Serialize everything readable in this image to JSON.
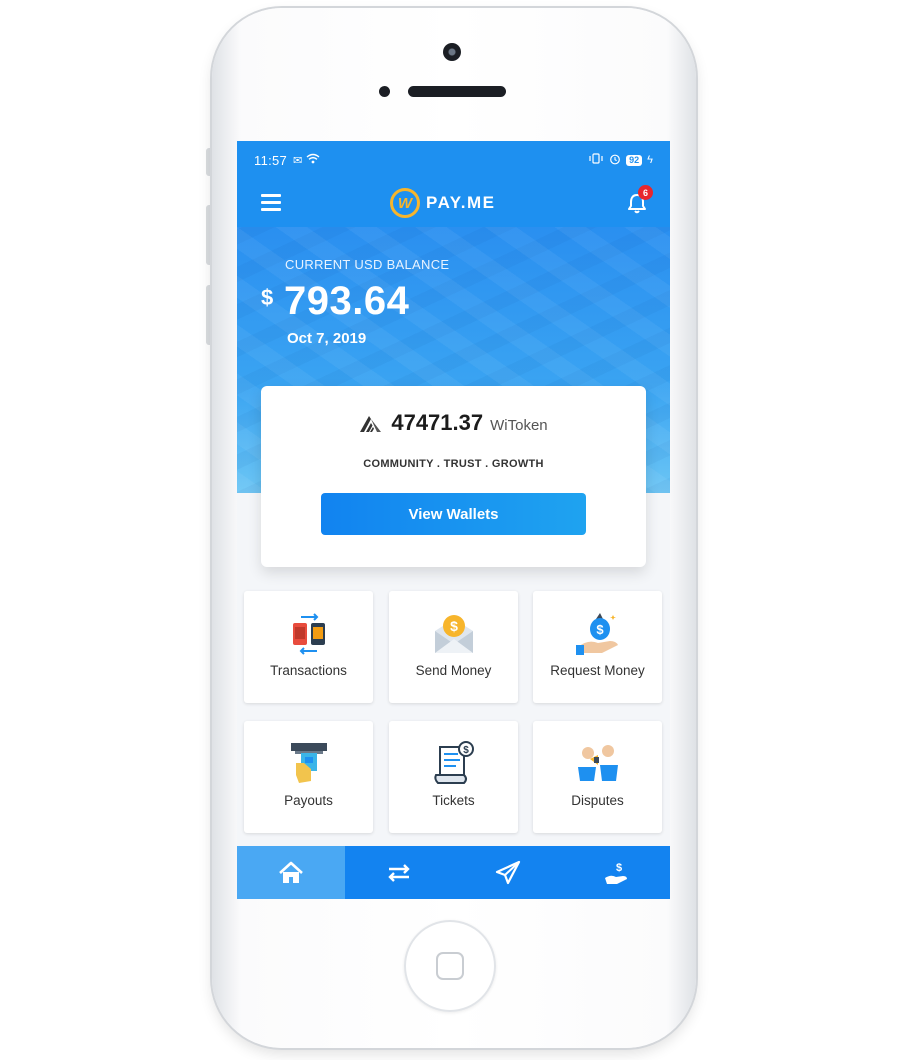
{
  "status_bar": {
    "time": "11:57",
    "left_icons": [
      "mail-icon",
      "wifi-icon"
    ],
    "right_icons": [
      "vibrate-icon",
      "alarm-icon"
    ],
    "battery": "92"
  },
  "header": {
    "logo_mark": "W",
    "logo_text": "PAY.ME",
    "notification_count": "6"
  },
  "balance": {
    "label": "CURRENT USD BALANCE",
    "currency_symbol": "$",
    "amount": "793.64",
    "date": "Oct 7, 2019"
  },
  "token_card": {
    "amount": "47471.37",
    "unit": "WiToken",
    "tagline": "COMMUNITY . TRUST . GROWTH",
    "button_label": "View Wallets"
  },
  "tiles": [
    {
      "label": "Transactions",
      "icon": "transactions-icon"
    },
    {
      "label": "Send Money",
      "icon": "send-money-icon"
    },
    {
      "label": "Request Money",
      "icon": "request-money-icon"
    },
    {
      "label": "Payouts",
      "icon": "payouts-icon"
    },
    {
      "label": "Tickets",
      "icon": "tickets-icon"
    },
    {
      "label": "Disputes",
      "icon": "disputes-icon"
    }
  ],
  "bottom_nav": [
    {
      "icon": "home-icon",
      "active": true
    },
    {
      "icon": "transfer-icon",
      "active": false
    },
    {
      "icon": "send-icon",
      "active": false
    },
    {
      "icon": "receive-money-icon",
      "active": false
    }
  ],
  "colors": {
    "brand_blue": "#1e90f0",
    "logo_gold": "#f7b52c",
    "badge_red": "#e8262d",
    "nav_active": "#4aa8f3"
  }
}
